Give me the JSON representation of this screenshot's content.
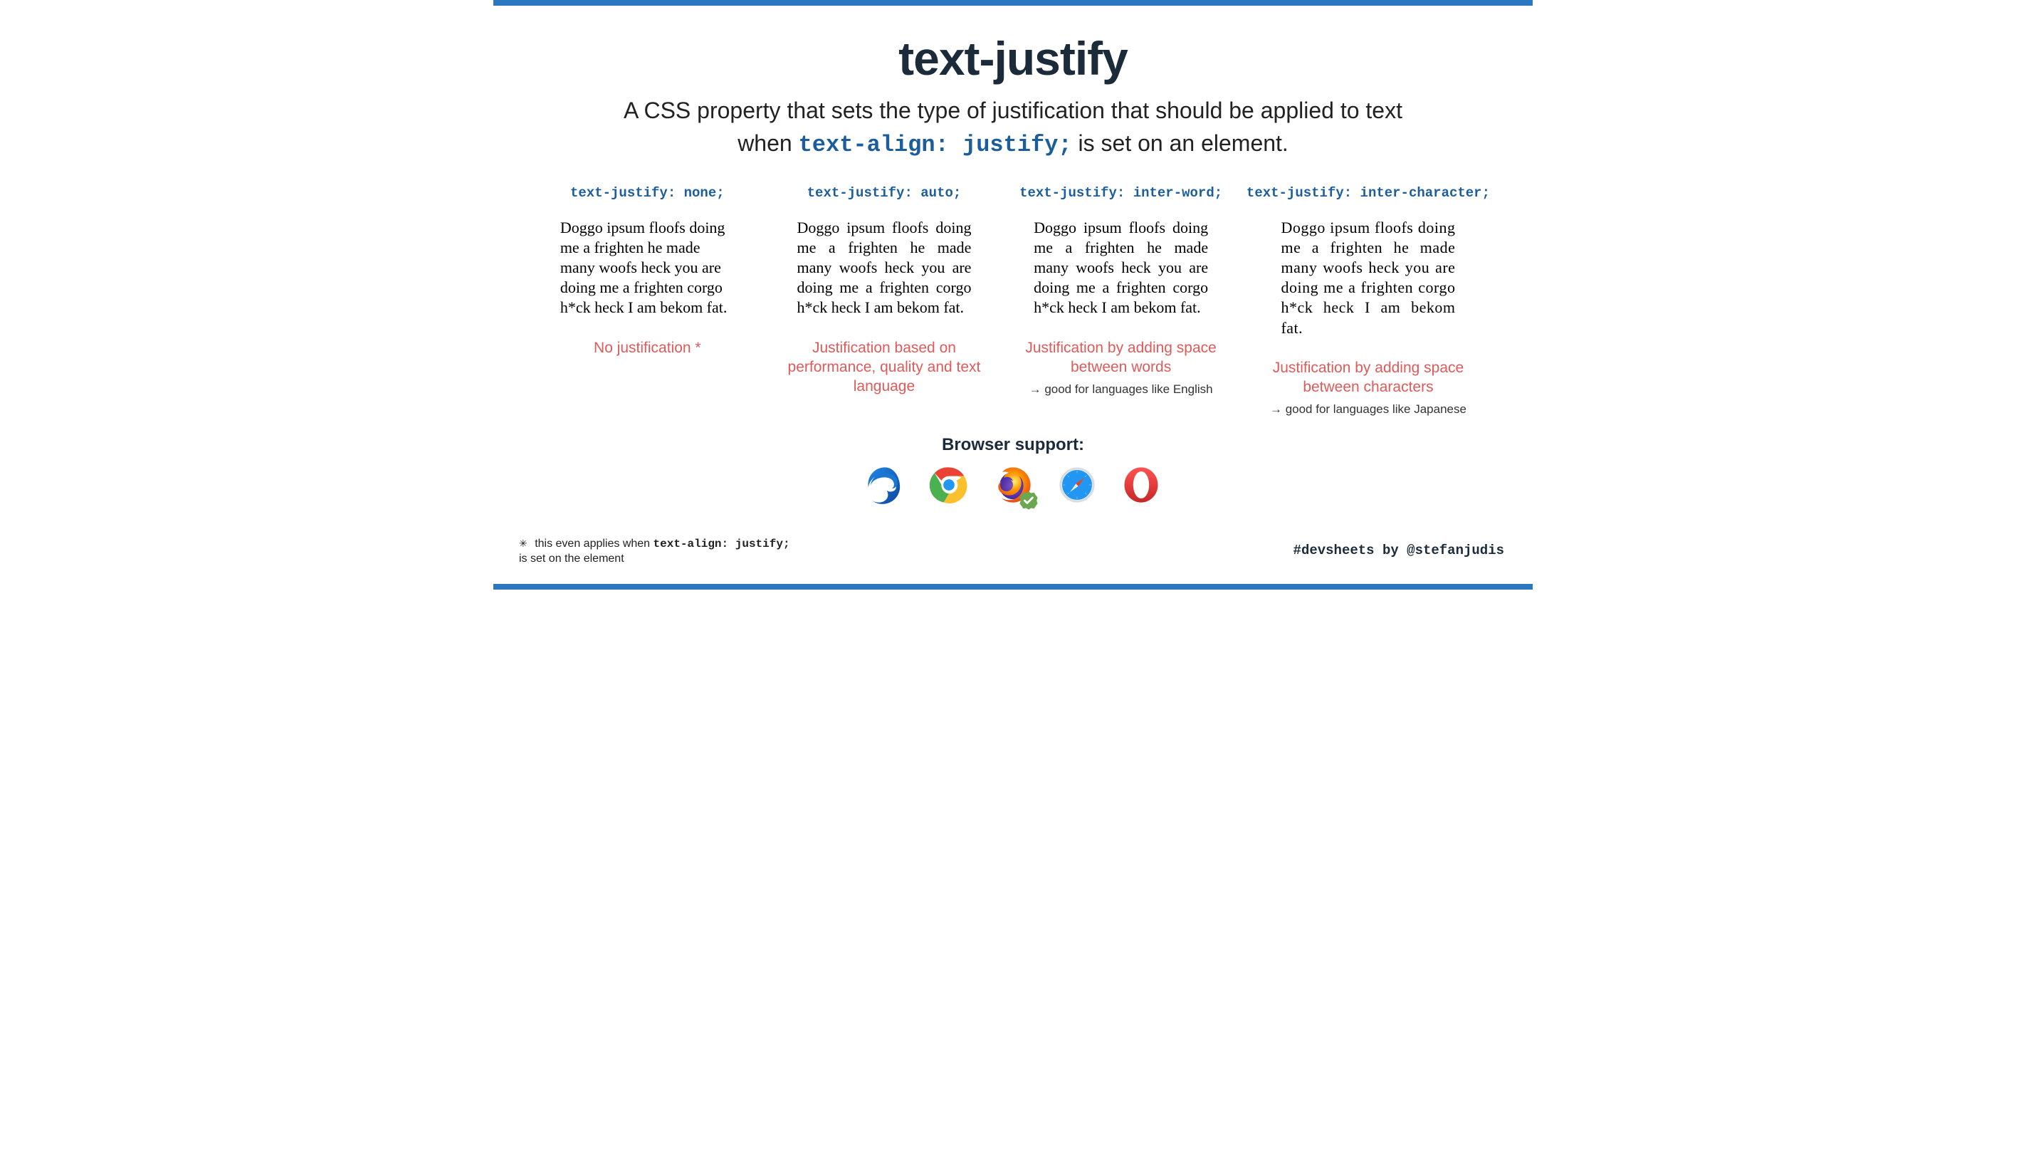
{
  "title": "text-justify",
  "subtitle_pre": "A CSS property that sets the type of justification that should be applied to text",
  "subtitle_when": "when ",
  "subtitle_code": "text-align: justify;",
  "subtitle_post": " is set on an element.",
  "sample_text": "Doggo ipsum floofs doing me a frighten he made many woofs heck you are doing me a frighten corgo h*ck heck I am bekom fat.",
  "columns": [
    {
      "head": "text-justify: none;",
      "caption": "No justification *",
      "hint": ""
    },
    {
      "head": "text-justify: auto;",
      "caption": "Justification based on performance, quality and text language",
      "hint": ""
    },
    {
      "head": "text-justify: inter-word;",
      "caption": "Justification by adding space between words",
      "hint": "→ good for languages like English"
    },
    {
      "head": "text-justify: inter-character;",
      "caption": "Justification by adding space between characters",
      "hint": "→ good for languages like Japanese"
    }
  ],
  "support_head": "Browser support:",
  "browsers": [
    "edge",
    "chrome",
    "firefox",
    "safari",
    "opera"
  ],
  "firefox_supported": true,
  "footnote_star": "✳",
  "footnote_pre": "this even applies when ",
  "footnote_code": "text-align: justify;",
  "footnote_post": "is set on the element",
  "credit": "#devsheets by @stefanjudis"
}
